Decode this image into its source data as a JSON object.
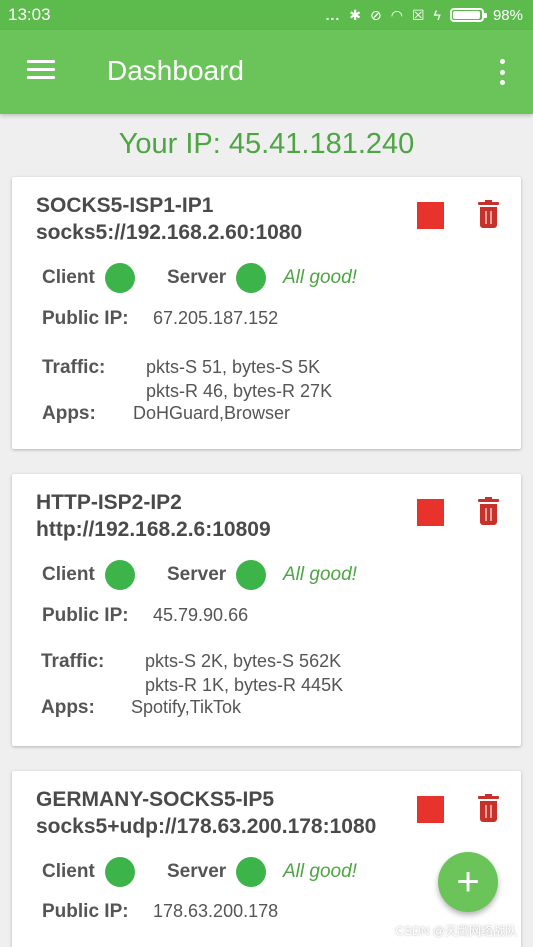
{
  "status_bar": {
    "time": "13:03",
    "dots": "...",
    "battery_percent_label": "98%",
    "battery_level": 0.98
  },
  "app_bar": {
    "title": "Dashboard"
  },
  "your_ip": "Your IP: 45.41.181.240",
  "labels": {
    "client": "Client",
    "server": "Server",
    "public_ip": "Public IP:",
    "traffic": "Traffic:",
    "apps": "Apps:"
  },
  "cards": [
    {
      "name": "SOCKS5-ISP1-IP1",
      "url": "socks5://192.168.2.60:1080",
      "status": "All good!",
      "public_ip": "67.205.187.152",
      "traffic_sent": "pkts-S 51,  bytes-S 5K",
      "traffic_recv": "pkts-R 46,  bytes-R 27K",
      "apps": "DoHGuard,Browser"
    },
    {
      "name": "HTTP-ISP2-IP2",
      "url": "http://192.168.2.6:10809",
      "status": "All good!",
      "public_ip": "45.79.90.66",
      "traffic_sent": "pkts-S 2K,  bytes-S 562K",
      "traffic_recv": "pkts-R 1K,  bytes-R 445K",
      "apps": "Spotify,TikTok"
    },
    {
      "name": "GERMANY-SOCKS5-IP5",
      "url": "socks5+udp://178.63.200.178:1080",
      "status": "All good!",
      "public_ip": "178.63.200.178"
    }
  ],
  "fab_label": "+",
  "watermark": "CSDN @天鹰网络战队",
  "colors": {
    "primary": "#6bc45a",
    "status_bar": "#5dbb4d",
    "ok_dot": "#3db449",
    "stop": "#e8322c",
    "trash": "#c8302a"
  }
}
